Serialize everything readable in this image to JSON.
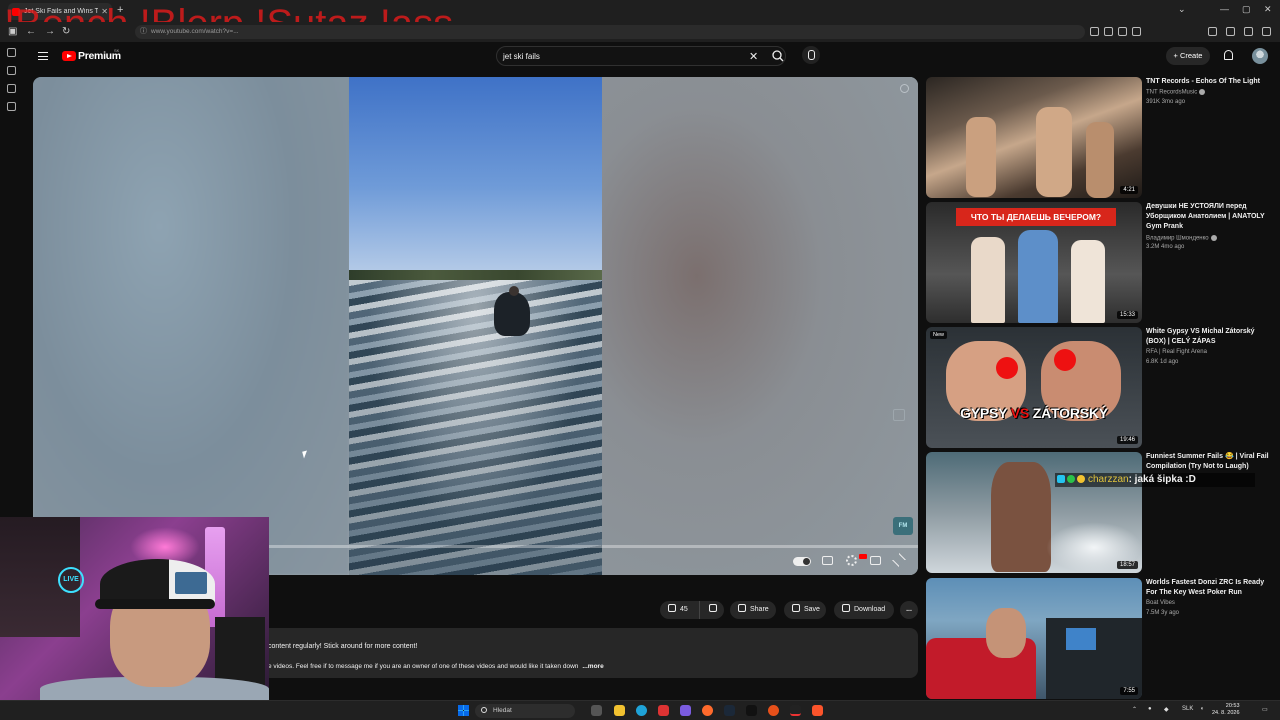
{
  "overlay_title": "!Bench !Blerp !Sutaz !ass",
  "browser": {
    "tab_title": "Jet Ski Fails and Wins This",
    "url": "www.youtube.com/watch?v=...",
    "new_tab": "+"
  },
  "youtube": {
    "brand": "Premium",
    "brand_sup": "SK",
    "search_query": "jet ski fails",
    "create_label": "Create"
  },
  "player": {
    "progress_fraction": 0.0
  },
  "actions": {
    "like_count": "45",
    "share_label": "Share",
    "save_label": "Save",
    "download_label": "Download",
    "more_label": "..."
  },
  "description": {
    "line1": "content regularly! Stick around for more content!",
    "line2": "e videos. Feel free if to message me if you are an owner of one of these videos and would like it taken down",
    "more_label": "...more"
  },
  "webcam": {
    "live_badge": "LIVE"
  },
  "recommendations": [
    {
      "title": "TNT Records - Echos Of The Light",
      "channel": "TNT RecordsMusic",
      "meta": "391K  3mo ago",
      "duration": "4:21",
      "verified": true
    },
    {
      "title": "Девушки НЕ УСТОЯЛИ перед Уборщиком Анатолием | ANATOLY Gym Prank",
      "channel": "Владимир Шмонденко",
      "meta": "3.2M  4mo ago",
      "duration": "15:33",
      "verified": true,
      "thumb_caption": "ЧТО ТЫ ДЕЛАЕШЬ ВЕЧЕРОМ?"
    },
    {
      "title": "White Gypsy VS Michal Zátorský (BOX) | CELÝ ZÁPAS",
      "channel": "RFA | Real Fight Arena",
      "meta": "6.8K  1d ago",
      "duration": "19:46",
      "badge": "New",
      "thumb_caption_a": "GYPSY",
      "thumb_caption_vs": "VS",
      "thumb_caption_b": "ZÁTORSKÝ"
    },
    {
      "title": "Funniest Summer Fails 😂 | Viral Fail Compilation (Try Not to Laugh)",
      "channel": "",
      "meta": "",
      "duration": "18:57"
    },
    {
      "title": "Worlds Fastest Donzi ZRC Is Ready For The Key West Poker Run",
      "channel": "Boat Vibes",
      "meta": "7.5M  3y ago",
      "duration": "7:55"
    }
  ],
  "chat": {
    "username": "charzzan",
    "message": ": jaká šipka :D"
  },
  "taskbar": {
    "search_label": "Hledat",
    "lang": "SLK",
    "time": "20:53",
    "date": "24. 8. 2026"
  }
}
